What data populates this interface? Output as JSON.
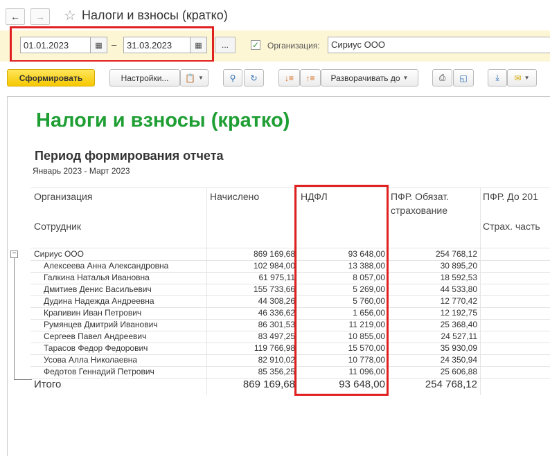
{
  "window": {
    "back_icon": "arrow-left-icon",
    "forward_icon": "arrow-right-icon",
    "favorite_icon": "star-icon",
    "title": "Налоги и взносы (кратко)"
  },
  "params": {
    "date_from": "01.01.2023",
    "date_to": "31.03.2023",
    "dash": "–",
    "period_button": "...",
    "org_checkbox_checked": true,
    "org_label": "Организация:",
    "org_value": "Сириус ООО"
  },
  "toolbar": {
    "generate": "Сформировать",
    "settings": "Настройки...",
    "expand_to": "Разворачивать до"
  },
  "report": {
    "title": "Налоги и взносы (кратко)",
    "period_heading": "Период формирования отчета",
    "period_value": "Январь 2023 - Март 2023",
    "columns": {
      "org": "Организация",
      "employee": "Сотрудник",
      "accrued": "Начислено",
      "ndfl": "НДФЛ",
      "pfr1": "ПФР. Обязат. страхование",
      "pfr2": "ПФР. До 201",
      "pfr2_sub": "Страх. часть"
    },
    "org_row": {
      "name": "Сириус ООО",
      "accrued": "869 169,68",
      "ndfl": "93 648,00",
      "pfr": "254 768,12"
    },
    "rows": [
      {
        "name": "Алексеева Анна Александровна",
        "accrued": "102 984,00",
        "ndfl": "13 388,00",
        "pfr": "30 895,20"
      },
      {
        "name": "Галкина Наталья Ивановна",
        "accrued": "61 975,11",
        "ndfl": "8 057,00",
        "pfr": "18 592,53"
      },
      {
        "name": "Дмитиев Денис Васильевич",
        "accrued": "155 733,66",
        "ndfl": "5 269,00",
        "pfr": "44 533,80"
      },
      {
        "name": "Дудина Надежда Андреевна",
        "accrued": "44 308,26",
        "ndfl": "5 760,00",
        "pfr": "12 770,42"
      },
      {
        "name": "Крапивин Иван Петрович",
        "accrued": "46 336,62",
        "ndfl": "1 656,00",
        "pfr": "12 192,75"
      },
      {
        "name": "Румянцев Дмитрий Иванович",
        "accrued": "86 301,53",
        "ndfl": "11 219,00",
        "pfr": "25 368,40"
      },
      {
        "name": "Сергеев Павел Андреевич",
        "accrued": "83 497,25",
        "ndfl": "10 855,00",
        "pfr": "24 527,11"
      },
      {
        "name": "Тарасов Федор Федорович",
        "accrued": "119 766,98",
        "ndfl": "15 570,00",
        "pfr": "35 930,09"
      },
      {
        "name": "Усова Алла Николаевна",
        "accrued": "82 910,02",
        "ndfl": "10 778,00",
        "pfr": "24 350,94"
      },
      {
        "name": "Федотов Геннадий Петрович",
        "accrued": "85 356,25",
        "ndfl": "11 096,00",
        "pfr": "25 606,88"
      }
    ],
    "total": {
      "label": "Итого",
      "accrued": "869 169,68",
      "ndfl": "93 648,00",
      "pfr": "254 768,12"
    }
  },
  "colors": {
    "title_green": "#1e9e33",
    "highlight_red": "#e01f1f",
    "primary_yellow": "#f5c800"
  }
}
